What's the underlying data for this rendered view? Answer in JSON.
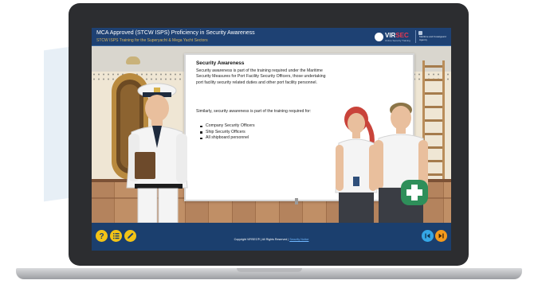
{
  "course": {
    "title": "MCA Approved (STCW ISPS) Proficiency in Security Awareness",
    "subtitle": "STCW ISPS Training for the Superyacht & Mega Yacht Sectors"
  },
  "branding": {
    "logo_main": "VIR",
    "logo_accent": "SEC",
    "logo_tagline": "Online Security Training",
    "agency": "Maritime and Coastguard Agency"
  },
  "panel": {
    "title": "Security Awareness",
    "paragraph1": "Security awareness is part of the training required under the Maritime Security Measures for Port Facility Security Officers, those undertaking port facility security related duties and other port facility personnel.",
    "paragraph2": "Similarly, security awareness is part of the training required for:",
    "bullets": [
      "Company Security Officers",
      "Ship Security Officers",
      "All shipboard personnel"
    ]
  },
  "footer": {
    "copyright": "Copyright VIRSEC® | All Rights Reserved | ",
    "link": "Security Notice"
  },
  "icons": {
    "help": "question-mark",
    "menu": "list",
    "notes": "pencil",
    "prev": "chevron-left",
    "next": "chevron-right"
  },
  "colors": {
    "header_bg": "#1e4173",
    "subtitle": "#d9b55a",
    "yellow_button": "#f2c316",
    "prev_button": "#35a7e6",
    "next_button": "#f39a1c"
  }
}
